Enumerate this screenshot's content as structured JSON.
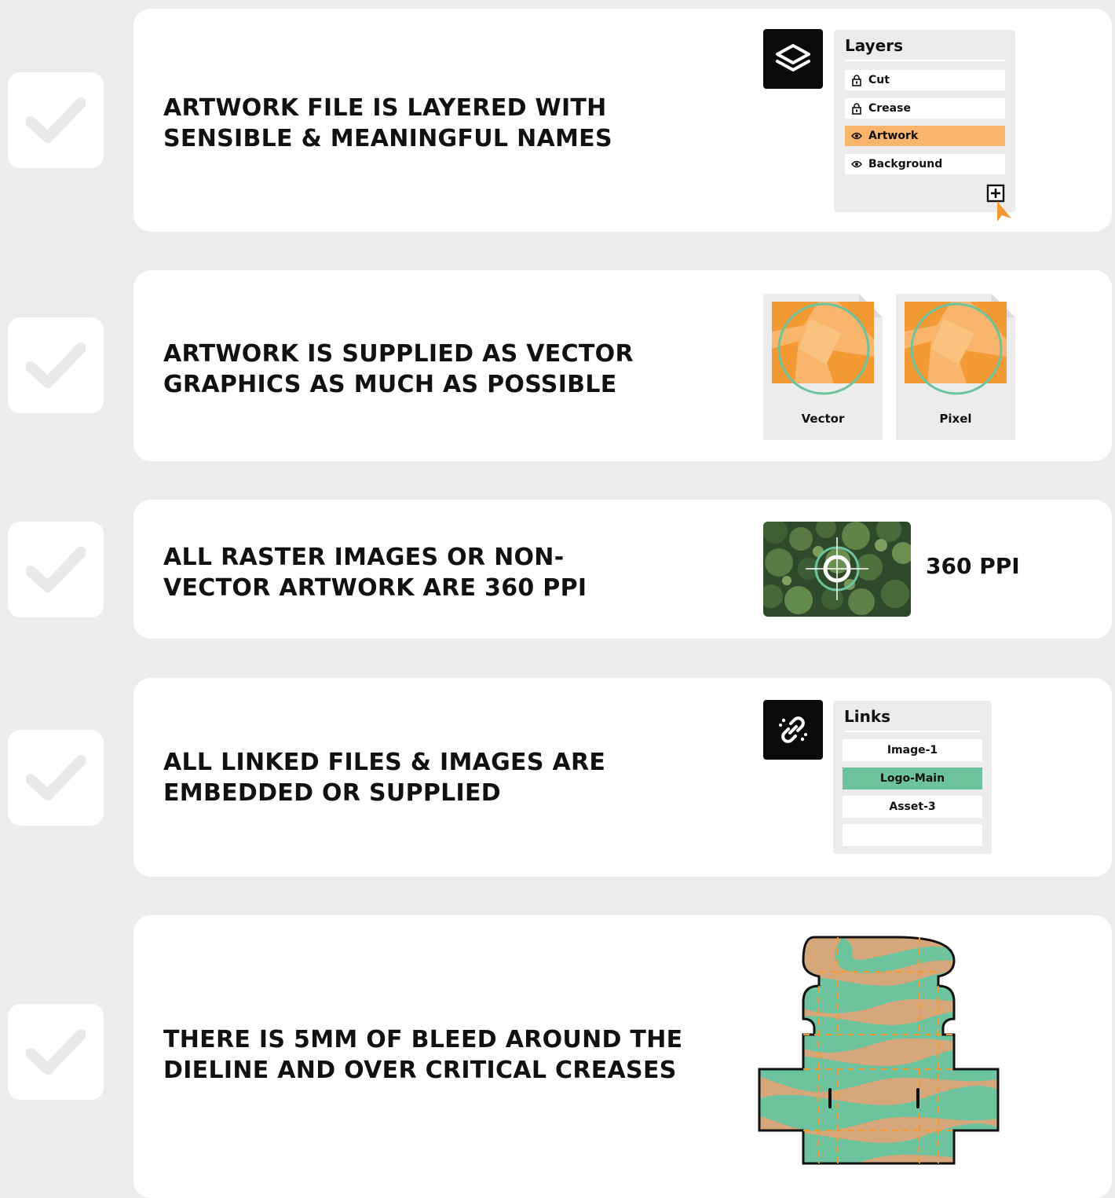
{
  "checklist": [
    {
      "title_line1": "ARTWORK FILE IS LAYERED WITH",
      "title_line2": "SENSIBLE & MEANINGFUL NAMES"
    },
    {
      "title_line1": "ARTWORK IS SUPPLIED AS VECTOR",
      "title_line2": "GRAPHICS AS MUCH AS POSSIBLE"
    },
    {
      "title_line1": "ALL RASTER IMAGES OR NON-",
      "title_line2": "VECTOR ARTWORK ARE 360 PPI"
    },
    {
      "title_line1": "ALL LINKED FILES & IMAGES ARE",
      "title_line2": "EMBEDDED OR SUPPLIED"
    },
    {
      "title_line1": "THERE IS 5MM OF BLEED AROUND THE",
      "title_line2": "DIELINE AND OVER CRITICAL CREASES"
    }
  ],
  "layers_panel": {
    "title": "Layers",
    "icon": "layers-icon",
    "items": [
      {
        "label": "Cut",
        "icon": "lock-icon",
        "active": false
      },
      {
        "label": "Crease",
        "icon": "lock-icon",
        "active": false
      },
      {
        "label": "Artwork",
        "icon": "eye-icon",
        "active": true
      },
      {
        "label": "Background",
        "icon": "eye-icon",
        "active": false
      }
    ],
    "add_icon": "add-layer-icon"
  },
  "file_types": [
    {
      "label": "Vector"
    },
    {
      "label": "Pixel"
    }
  ],
  "resolution": {
    "label": "360 PPI"
  },
  "links_panel": {
    "title": "Links",
    "icon": "link-icon",
    "items": [
      {
        "label": "Image-1",
        "active": false
      },
      {
        "label": "Logo-Main",
        "active": true
      },
      {
        "label": "Asset-3",
        "active": false
      },
      {
        "label": "",
        "active": false
      }
    ]
  },
  "colors": {
    "background": "#ececea",
    "accent_orange": "#f39a34",
    "light_orange": "#f9b56b",
    "accent_green": "#6cc39e",
    "kraft": "#d6a77a"
  }
}
